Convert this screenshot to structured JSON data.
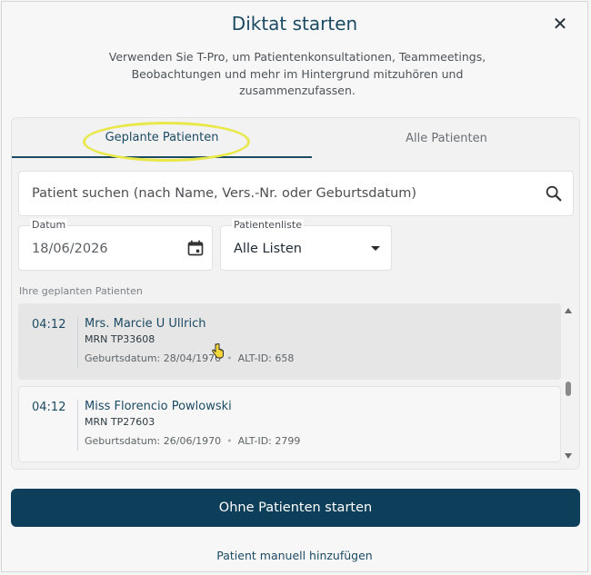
{
  "dialog": {
    "title": "Diktat starten",
    "description": "Verwenden Sie T-Pro, um Patientenkonsultationen, Teammeetings, Beobachtungen und mehr im Hintergrund mitzuhören und zusammenzufassen."
  },
  "tabs": [
    {
      "label": "Geplante Patienten",
      "active": true
    },
    {
      "label": "Alle Patienten",
      "active": false
    }
  ],
  "search": {
    "placeholder": "Patient suchen (nach Name, Vers.-Nr. oder Geburtsdatum)"
  },
  "date_field": {
    "label": "Datum",
    "value": "18/06/2026"
  },
  "list_field": {
    "label": "Patientenliste",
    "value": "Alle Listen"
  },
  "section_label": "Ihre geplanten Patienten",
  "patients": [
    {
      "time": "04:12",
      "name": "Mrs. Marcie U Ullrich",
      "mrn": "MRN TP33608",
      "dob": "Geburtsdatum: 28/04/1970",
      "alt": "ALT-ID: 658",
      "selected": true
    },
    {
      "time": "04:12",
      "name": "Miss Florencio Powlowski",
      "mrn": "MRN TP27603",
      "dob": "Geburtsdatum: 26/06/1970",
      "alt": "ALT-ID: 2799",
      "selected": false
    }
  ],
  "actions": {
    "primary": "Ohne Patienten starten",
    "secondary": "Patient manuell hinzufügen"
  },
  "colors": {
    "accent": "#0e3f5a",
    "highlight_ring": "#e8e84a"
  }
}
